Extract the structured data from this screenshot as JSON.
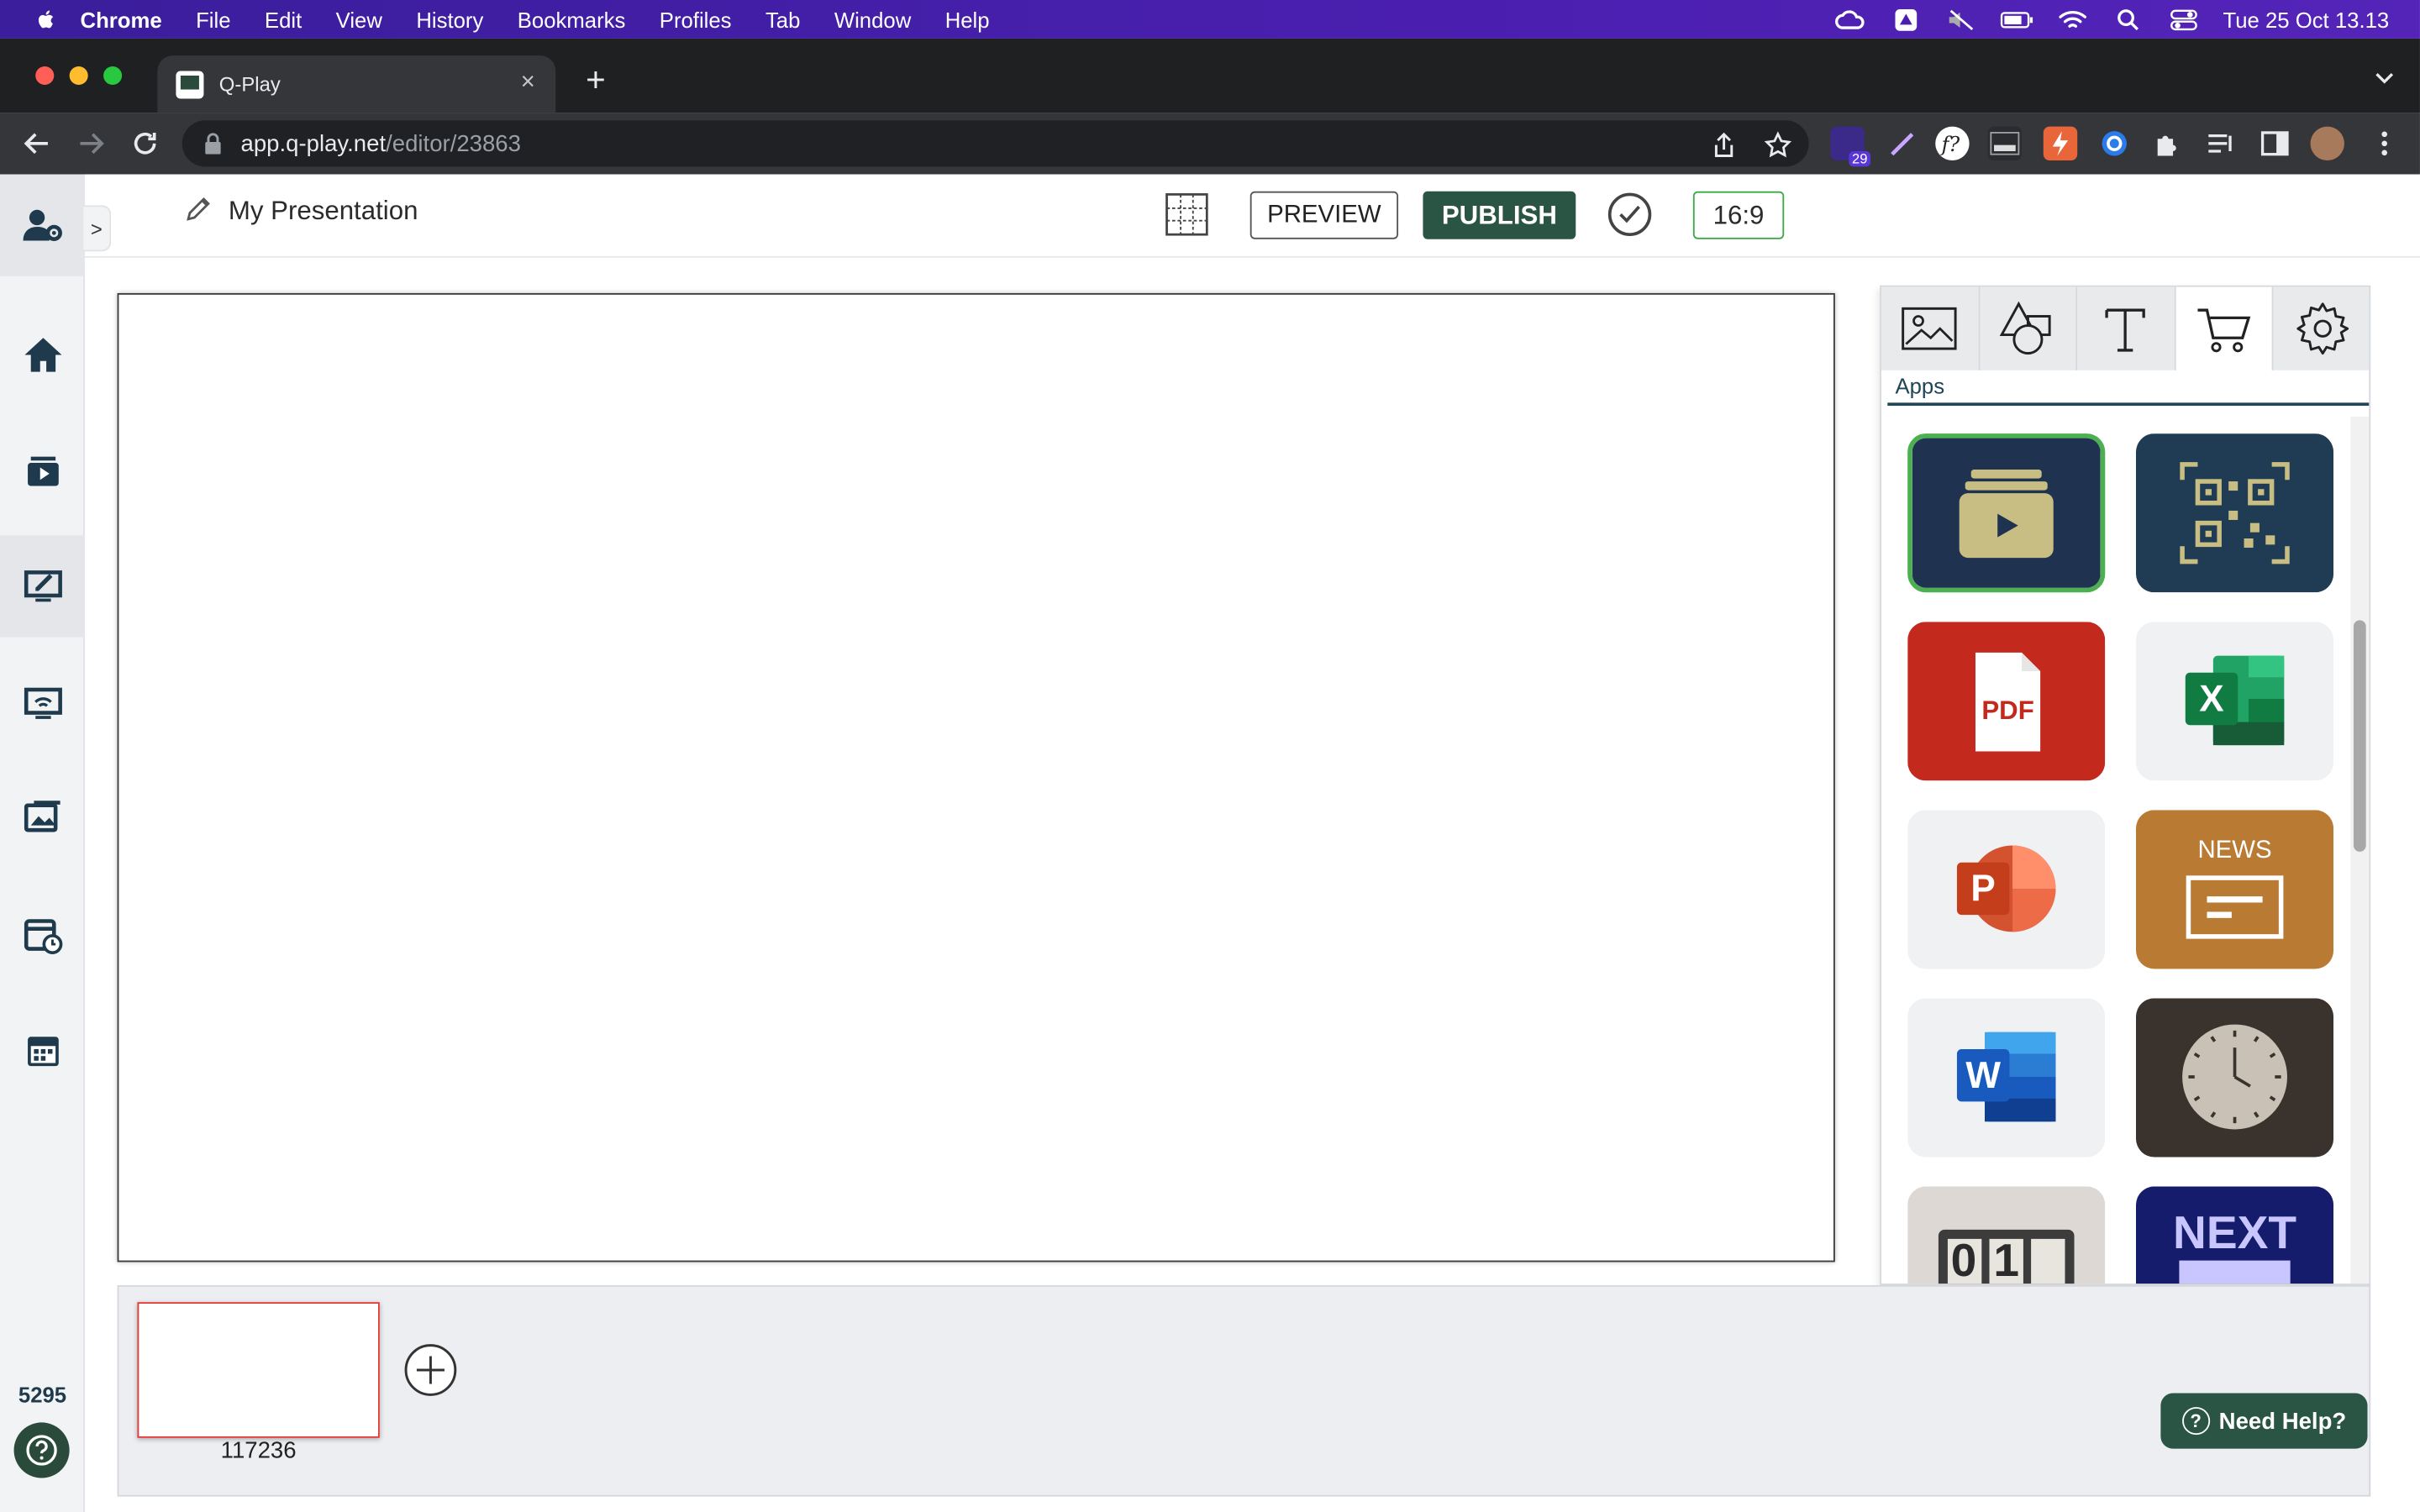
{
  "menubar": {
    "app": "Chrome",
    "items": [
      "File",
      "Edit",
      "View",
      "History",
      "Bookmarks",
      "Profiles",
      "Tab",
      "Window",
      "Help"
    ],
    "clock": "Tue 25 Oct  13.13"
  },
  "browser": {
    "tab_title": "Q-Play",
    "url_host": "app.q-play.net",
    "url_path": "/editor/23863",
    "extension_badge": "29"
  },
  "editor": {
    "title": "My Presentation",
    "preview_label": "PREVIEW",
    "publish_label": "PUBLISH",
    "aspect_ratio": "16:9",
    "expander": ">"
  },
  "leftnav": {
    "version": "5295"
  },
  "panel": {
    "section_label": "Apps",
    "apps": [
      {
        "name": "media-playlist-app-icon",
        "bg": "#1f3350"
      },
      {
        "name": "qr-code-app-icon",
        "bg": "#203c54"
      },
      {
        "name": "pdf-app-icon",
        "bg": "#c4291e",
        "label": "PDF"
      },
      {
        "name": "excel-app-icon",
        "bg": "#f0f1f3",
        "label": "X"
      },
      {
        "name": "powerpoint-app-icon",
        "bg": "#f0f1f3",
        "label": "P"
      },
      {
        "name": "news-app-icon",
        "bg": "#b97b33",
        "label": "NEWS"
      },
      {
        "name": "word-app-icon",
        "bg": "#f0f1f3",
        "label": "W"
      },
      {
        "name": "clock-app-icon",
        "bg": "#3a322d"
      },
      {
        "name": "counter-app-icon",
        "bg": "#ddd8d3",
        "label": "01"
      },
      {
        "name": "next-queue-app-icon",
        "bg": "#141c6b",
        "label": "NEXT"
      }
    ]
  },
  "slides": [
    {
      "id": "117236"
    }
  ],
  "help": {
    "label": "Need Help?"
  },
  "colors": {
    "brand_green": "#2a5545",
    "ratio_border": "#3aa843",
    "selected_slide_border": "#e53935"
  }
}
